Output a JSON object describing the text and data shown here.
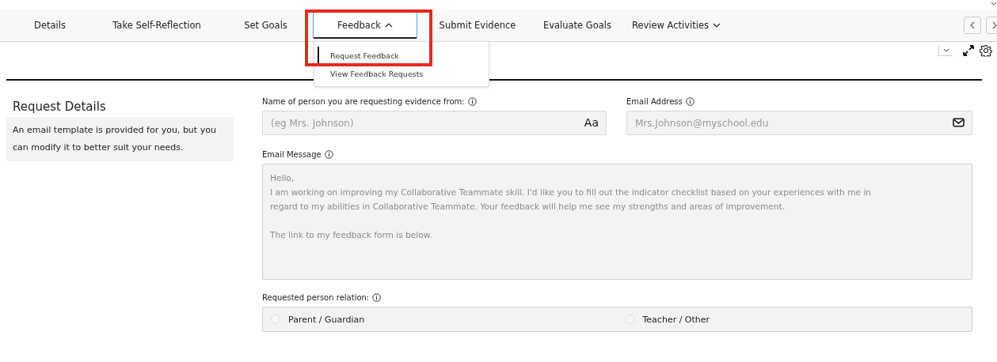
{
  "tabs": [
    {
      "label": "Details",
      "selected": false,
      "kind": "plain"
    },
    {
      "label": "Take Self-Reflection",
      "selected": false,
      "kind": "plain"
    },
    {
      "label": "Set Goals",
      "selected": false,
      "kind": "plain"
    },
    {
      "label": "Feedback",
      "selected": true,
      "kind": "menu",
      "expanded": true
    },
    {
      "label": "Submit Evidence",
      "selected": false,
      "kind": "plain"
    },
    {
      "label": "Evaluate Goals",
      "selected": false,
      "kind": "plain"
    },
    {
      "label": "Review Activities",
      "selected": false,
      "kind": "menu",
      "expanded": false
    }
  ],
  "dropdown": {
    "items": [
      {
        "label": "Request Feedback",
        "selected": true
      },
      {
        "label": "View Feedback Requests",
        "selected": false
      }
    ]
  },
  "sidebar": {
    "title": "Request Details",
    "note": "An email template is provided for you, but you can modify it to better suit your needs."
  },
  "form": {
    "name_field": {
      "label": "Name of person you are requesting evidence from:",
      "placeholder": "(eg Mrs. Johnson)",
      "suffix": "Aa"
    },
    "email_field": {
      "label": "Email Address",
      "placeholder": "Mrs.Johnson@myschool.edu"
    },
    "message": {
      "label": "Email Message",
      "value": "Hello,\nI am working on improving my Collaborative Teammate skill. I'd like you to fill out the indicator checklist based on your experiences with me in\nregard to my abilities in Collaborative Teammate. Your feedback will help me see my strengths and areas of improvement.\n\nThe link to my feedback form is below."
    },
    "relation": {
      "label": "Requested person relation:",
      "options": [
        {
          "label": "Parent / Guardian",
          "selected": false
        },
        {
          "label": "Teacher / Other",
          "selected": false
        }
      ]
    }
  }
}
